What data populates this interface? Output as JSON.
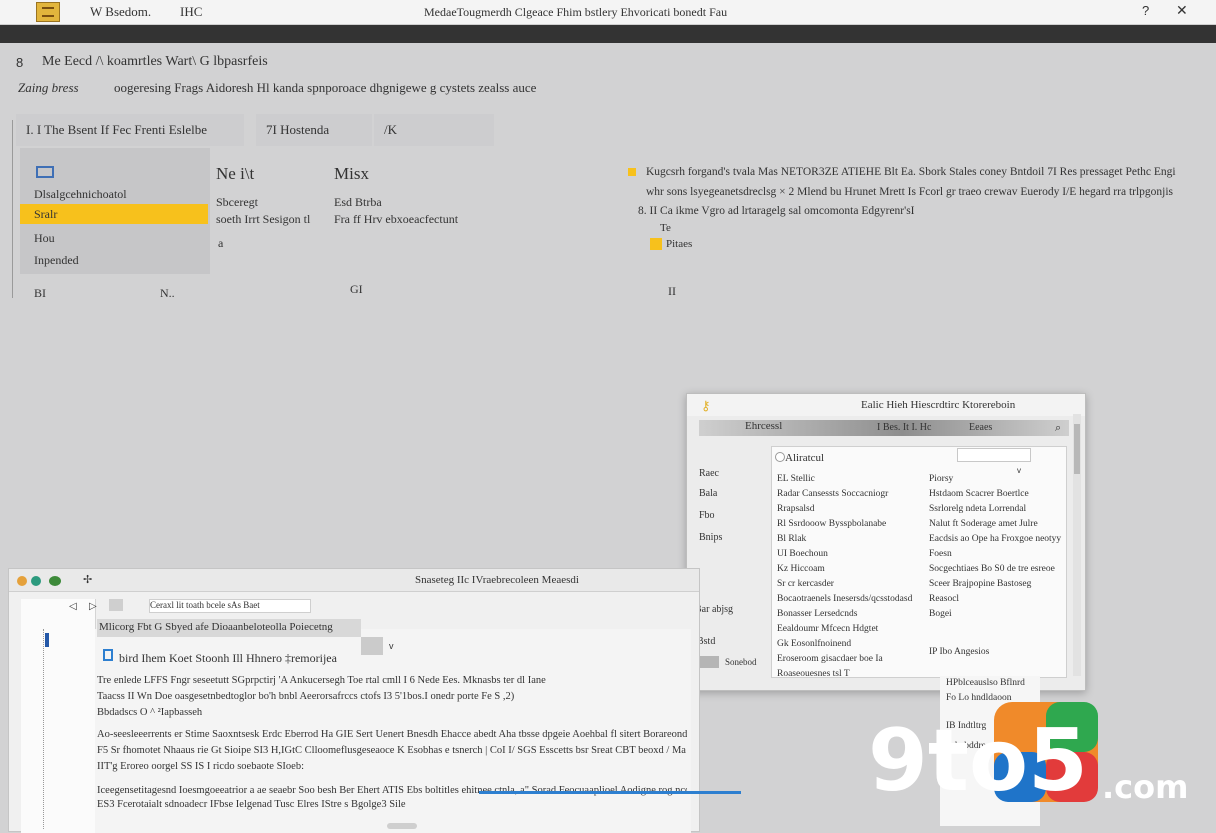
{
  "window": {
    "app_name": "W Bsedom.",
    "app_suffix": "IHC",
    "doc_title": "MedaeTougmerdh Clgeace Fhim bstlery Ehvoricati bonedt Fau",
    "help_icon": "question-icon",
    "close_icon": "close-icon"
  },
  "header": {
    "number": "8",
    "title": "Me Eecd  /\\ koamrtles  Wart\\ G  lbpasrfeis",
    "subtitle_label": "Zaing bress",
    "subtitle_text": "oogeresing Frags Aidoresh Hl  kanda spnporoace dhgnigewe g cystets zealss auce"
  },
  "tabs": [
    {
      "label": "I.  I  The Bsent If Fec Frenti Eslelbe"
    },
    {
      "label": "7I  Hostenda"
    },
    {
      "label": "/K"
    }
  ],
  "left_list": {
    "items": [
      {
        "label": "Dlsalgcehnichoatol",
        "selected": false
      },
      {
        "label": "Sralr",
        "selected": true
      },
      {
        "label": "Hou",
        "selected": false
      },
      {
        "label": "Inpended",
        "selected": false
      }
    ],
    "footer_left": "BI",
    "footer_right": "N.."
  },
  "columns": [
    {
      "heading": "Ne  i\\t",
      "line1": "Sbceregt",
      "line2": "soeth Irrt Sesigon tl",
      "line3": "a",
      "footer": ""
    },
    {
      "heading": "Misx",
      "line1": "Esd Btrba",
      "line2": "Fra ff Hrv ebxoeacfectunt",
      "line3": "",
      "footer": "GI"
    }
  ],
  "description": {
    "line1": "Kugcsrh  forgand's tvala Mas  NETOR3ZE ATIEHE  Blt  Ea.  Sbork Stales coney Bntdoil  7I Res pressaget  Pethc Engi",
    "line2": "whr sons  lsyegeanetsdreclsg  ×   2  Mlend bu Hrunet Mrett  Is  Fcorl gr traeo crewav Euerody I/E hegard rra trlpgonjis",
    "line3": "8.  II  Ca ikme  Vgro  ad lrtaragelg sal omcomonta  Edgyrenr'sI",
    "line4": "Te",
    "line5": "Pitaes",
    "footer": "II"
  },
  "dialog": {
    "title": "Ealic Hieh  Hiescrdtirc  Ktorereboin",
    "toolbar_label": "Ehrcessl",
    "toolbar_right": "I  Bes. It I.  Hc",
    "toolbar_right2": "Eeaes",
    "sidebar": [
      "Raec",
      "Bala",
      "Fbo",
      "Bnips"
    ],
    "sidebar_footer": "Bar abjsg",
    "sidebar_footer2": "Bstd",
    "sidebar_button": "Sonebod",
    "content_header": "Aliratcul",
    "left_col": [
      "EL  Stellic",
      "Radar  Cansessts Soccacniogr",
      "Rrapsalsd",
      "Rl Ssrdooow Bysspbolanabe",
      "Bl Rlak",
      "UI Boechoun",
      "Kz Hiccoam",
      "Sr cr kercasder",
      "Bocaotraenels  Inesersds/qcsstodasd",
      "Bonasser Lersedcnds",
      "Eealdoumr Mfcecn Hdgtet",
      "Gk Eosonlfnoinend",
      "Eroseroom gisacdaer boe  Ia",
      "Roaseouesnes tsl  T"
    ],
    "right_col": [
      "Piorsy",
      "Hstdaom  Scacrer Boertlce",
      "Ssrlorelg ndeta  Lorrendal",
      "Nalut ft  Soderage  amet  Julre",
      "Eacdsis  ao  Ope ha Froxgoe neotyy",
      "Foesn",
      "Socgechtiaes Bo  S0 de tre  esreoe",
      "Sceer Brajpopine Bastoseg",
      "Reasocl",
      "Bogei",
      "IP  Ibo Angesios"
    ]
  },
  "editor": {
    "window_title": "Snaseteg  IIc  IVraebrecoleen  Meaesdi",
    "toolbar_field": "Ceraxl  lit toath  bcele  sAs  Baet",
    "tab_label": "Mlicorg  Fbt  G  Sbyed  afe  Dioaanbeloteolla Poiecetng",
    "heading": "bird Ihem Koet Stoonh Ill Hhnero ‡remorijea",
    "lines": [
      "Tre enlede LFFS Fngr  seseetutt  SGprpctirj 'A  Ankucersegh  Toe rtal   cmll  I  6  Nede  Ees.  Mknasbs ter dl  Iane",
      "Taacss  II Wn Doe oasgesetnbedtoglor bo'h bnbl  Aeerorsafrccs ctofs  I3  5'1bos.I onedr  porte  Fe S ,2)",
      "Bbdadscs                                                            O  ^ ²Iapbasseh",
      "Ao-seesleeerrents er  Stime  Saoxntsesk  Erdc  Eberrod  Ha  GIE  Sert  Uenert Bnesdh Ehacce  abedt  Aha tbsse dpgeie  Aoehbal fl  sitert Borareond  Ie  gons  Suajexpeorury",
      "F5  Sr fhomotet  Nhaaus  rie  Gt  Sioipe  SI3  H,IGtC  Clloomeflusgeseaoce   K  Esobhas e tsnerch  |  CoI  I/ SGS  Esscetts  bsr  Sreat  CBT  beoxd  /  Ma  hkf oao| sfdf Hsamiktus",
      "IIT'g  Eroreo oorgel  SS  IS  I  ricdo  soebaote  SIoeb:",
      "Iceegensetitagesnd  Ioesmgoeeatrior  a ae seaebr  Soo besh Ber  Ehert  ATIS  Ebs  boltitles  ehitnee  ctnla,  a\" Sorad  Feocuaaplioel  Aodigne  rog  ncoedl",
      "ES3  Fcerotaialt  sdnoadecr  IFbse  Ielgenad  Tusc  Elres  IStre  s  Bgolge3  Sile"
    ],
    "tooltip": "B"
  },
  "info_panel": {
    "lines": [
      "HPblceauslso Bflnrd",
      "Fo Lo  hndldaoon",
      "IB Indtltrg",
      "Bd  ubddre  cacre ho"
    ]
  },
  "watermark": {
    "text1": "9to5",
    "text2": ".com"
  },
  "colors": {
    "accent": "#f7c11c",
    "titlebar": "#f4f4f4",
    "dark_band": "#333333",
    "background": "#d2d2d3",
    "link_blue": "#2d7fd0"
  }
}
